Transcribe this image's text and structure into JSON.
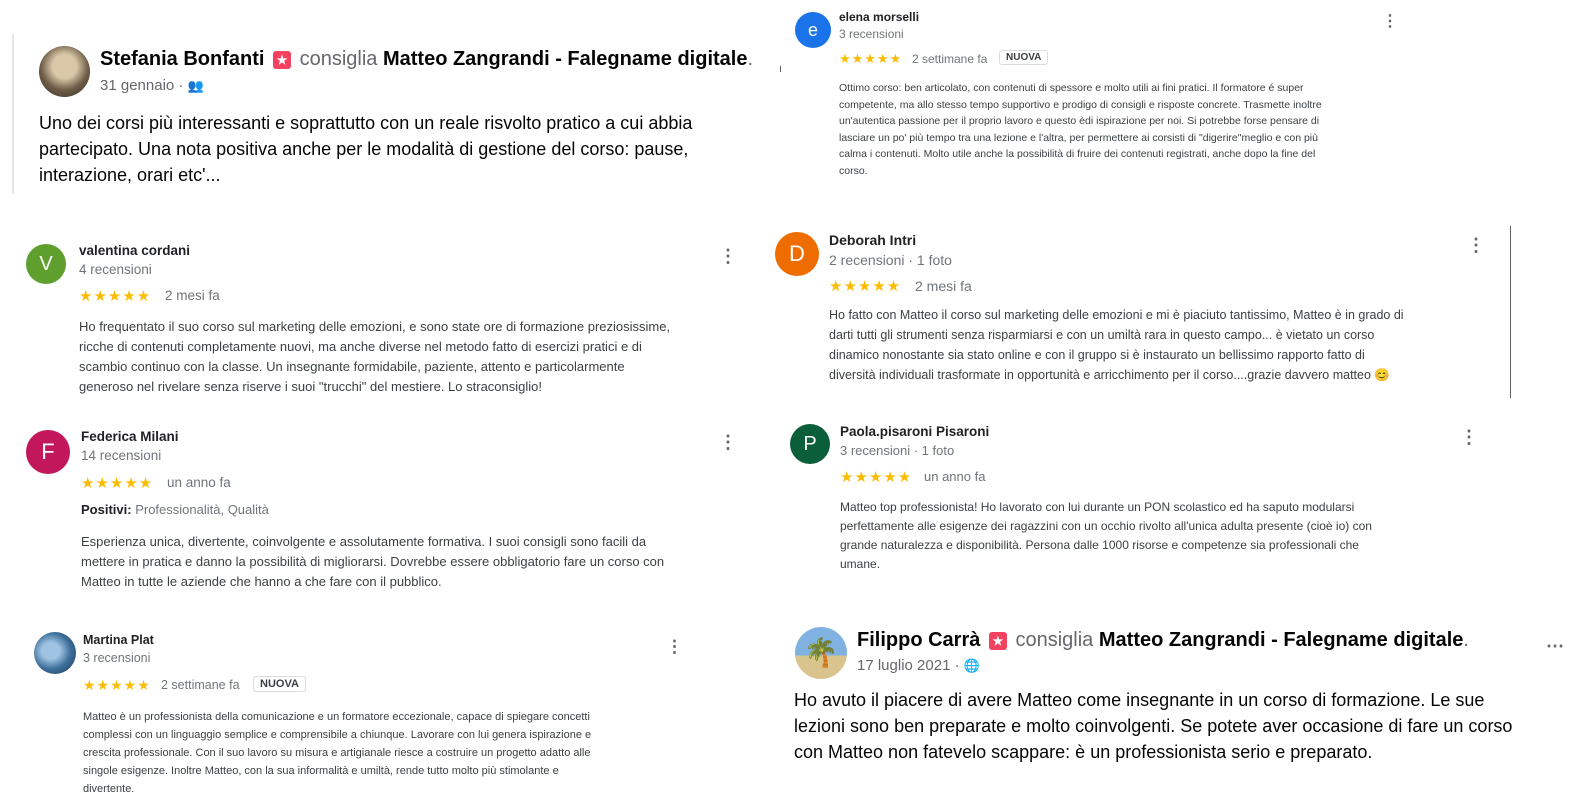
{
  "fb_post_1": {
    "name": "Stefania Bonfanti",
    "recommend_icon": "recommend-badge-icon",
    "verb": "consiglia",
    "page": "Matteo Zangrandi - Falegname digitale",
    "page_end": ".",
    "date": "31 gennaio ·",
    "audience_icon": "friends-icon",
    "text": "Uno dei corsi più interessanti e soprattutto con un reale risvolto pratico a cui abbia\npartecipato. Una nota positiva anche per le modalità di gestione del corso: pause,\ninterazione, orari etc'..."
  },
  "review_elena": {
    "initial": "e",
    "avatar_color": "#1a73e8",
    "name": "elena morselli",
    "meta": "3 recensioni",
    "stars": "★★★★★",
    "when": "2 settimane fa",
    "badge": "NUOVA",
    "text": "Ottimo corso: ben articolato, con contenuti di spessore e molto utili ai fini pratici. Il formatore é super\ncompetente, ma allo stesso tempo supportivo e prodigo di consigli e risposte concrete. Trasmette inoltre\nun'autentica passione per il proprio lavoro e questo èdi ispirazione per noi. Si potrebbe forse pensare di\nlasciare un po' più tempo tra una lezione e l'altra, per permettere ai corsisti di \"digerire\"meglio e con più\ncalma i contenuti. Molto utile anche la possibilità di fruire dei contenuti registrati, anche dopo la fine del\ncorso."
  },
  "review_valentina": {
    "initial": "V",
    "avatar_color": "#5e9f2e",
    "name": "valentina cordani",
    "meta": "4 recensioni",
    "stars": "★★★★★",
    "when": "2 mesi fa",
    "text": "Ho frequentato il suo corso sul marketing delle emozioni, e sono state ore di formazione preziosissime,\nricche di contenuti completamente nuovi, ma anche diverse nel metodo fatto di esercizi pratici e di\nscambio continuo con la classe. Un insegnante formidabile, paziente, attento e particolarmente\ngeneroso nel rivelare senza riserve i suoi \"trucchi\" del mestiere. Lo straconsiglio!"
  },
  "review_deborah": {
    "initial": "D",
    "avatar_color": "#ef6c00",
    "name": "Deborah Intri",
    "meta": "2 recensioni · 1 foto",
    "stars": "★★★★★",
    "when": "2 mesi fa",
    "text": "Ho fatto con Matteo il corso sul marketing delle emozioni e mi è piaciuto tantissimo, Matteo è in grado di\ndarti tutti gli strumenti senza risparmiarsi e con un umiltà rara in questo campo... è vietato un corso\ndinamico nonostante sia stato online e con il gruppo si è instaurato un bellissimo rapporto fatto di\ndiversità individuali trasformate in opportunità e arricchimento per il corso....grazie davvero matteo 😊"
  },
  "review_federica": {
    "initial": "F",
    "avatar_color": "#c2185b",
    "name": "Federica Milani",
    "meta": "14 recensioni",
    "stars": "★★★★★",
    "when": "un anno fa",
    "positives_label": "Positivi:",
    "positives_value": "Professionalità, Qualità",
    "text": "Esperienza unica, divertente, coinvolgente e assolutamente formativa. I suoi consigli sono facili da\nmettere in pratica e danno la possibilità di migliorarsi. Dovrebbe essere obbligatorio fare un corso con\nMatteo in tutte le aziende che hanno a che fare con il pubblico."
  },
  "review_paola": {
    "initial": "P",
    "avatar_color": "#0b5e3a",
    "name": "Paola.pisaroni Pisaroni",
    "meta": "3 recensioni · 1 foto",
    "stars": "★★★★★",
    "when": "un anno fa",
    "text": "Matteo top professionista! Ho lavorato con lui durante un PON scolastico ed ha saputo modularsi\nperfettamente alle esigenze dei ragazzini con un occhio rivolto all'unica adulta presente (cioè io) con\ngrande naturalezza e disponibilità. Persona dalle 1000 risorse e competenze sia professionali che\numane."
  },
  "review_martina": {
    "name": "Martina Plat",
    "meta": "3 recensioni",
    "stars": "★★★★★",
    "when": "2 settimane fa",
    "badge": "NUOVA",
    "text": "Matteo è un professionista della comunicazione e un formatore eccezionale, capace di spiegare concetti\ncomplessi con un linguaggio semplice e comprensibile a chiunque. Lavorare con lui genera ispirazione e\ncrescita professionale. Con il suo lavoro su misura e artigianale riesce a costruire un progetto adatto alle\nsingole esigenze. Inoltre Matteo, con la sua informalità e umiltà, rende tutto molto più stimolante e\ndivertente."
  },
  "fb_post_2": {
    "name": "Filippo Carrà",
    "recommend_icon": "recommend-badge-icon",
    "verb": "consiglia",
    "page": "Matteo Zangrandi - Falegname digitale",
    "page_end": ".",
    "date": "17 luglio 2021 ·",
    "audience_icon": "globe-icon",
    "text": "Ho avuto il piacere di avere Matteo come insegnante in un corso di formazione. Le sue\nlezioni sono ben preparate e molto coinvolgenti. Se potete aver occasione di fare un corso\ncon Matteo non fatevelo scappare: è un professionista serio e preparato."
  },
  "colors": {
    "star": "#fbbc04",
    "recommend": "#f3425f"
  }
}
